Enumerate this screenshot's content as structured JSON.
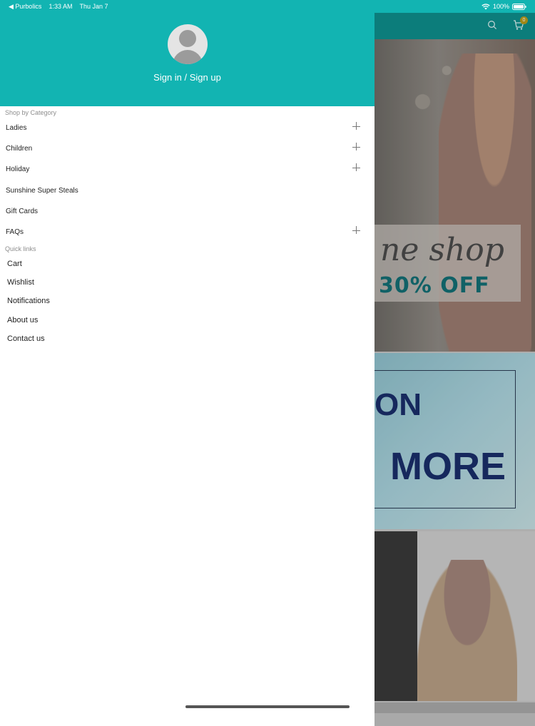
{
  "status_bar": {
    "back_app": "◀ Purbolics",
    "time": "1:33 AM",
    "date": "Thu Jan 7",
    "battery": "100%"
  },
  "background": {
    "cart_count": "0",
    "banner1": {
      "promo_script": "ne shop",
      "promo_off": "30% OFF"
    },
    "banner2": {
      "line1": "ON",
      "line2": "MORE"
    }
  },
  "drawer": {
    "sign_in_label": "Sign in / Sign up",
    "category_section": "Shop by Category",
    "categories": [
      {
        "label": "Ladies",
        "expandable": true
      },
      {
        "label": "Children",
        "expandable": true
      },
      {
        "label": "Holiday",
        "expandable": true
      },
      {
        "label": "Sunshine Super Steals",
        "expandable": false
      },
      {
        "label": "Gift Cards",
        "expandable": false
      },
      {
        "label": "FAQs",
        "expandable": true
      }
    ],
    "quick_section": "Quick links",
    "quick_links": [
      "Cart",
      "Wishlist",
      "Notifications",
      "About us",
      "Contact us"
    ]
  },
  "colors": {
    "brand_teal": "#12b4b2",
    "header_dark_teal": "#0e8f8d"
  }
}
